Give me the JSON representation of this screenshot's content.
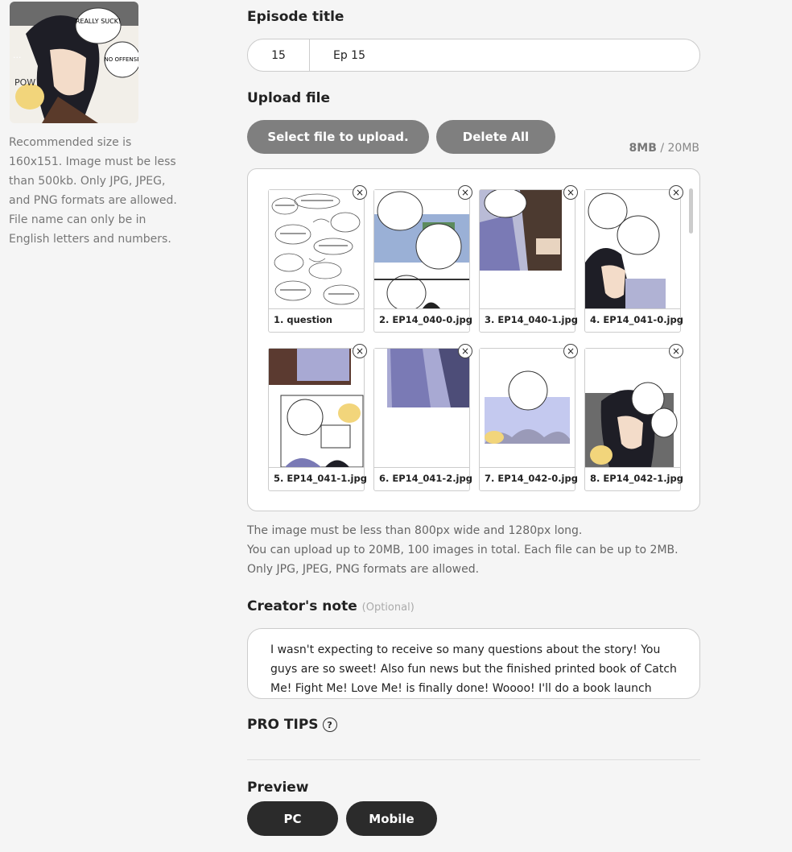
{
  "thumbnail": {
    "bubble1": "REALLY SUCK!",
    "bubble2": "NO OFFENSE",
    "sfx1": "...",
    "sfx2": "POW"
  },
  "thumbnail_help": "Recommended size is 160x151. Image must be less than 500kb. Only JPG, JPEG, and PNG formats are allowed. File name can only be in English letters and numbers.",
  "episode": {
    "label": "Episode title",
    "number": "15",
    "title": "Ep 15"
  },
  "upload": {
    "label": "Upload file",
    "select_button": "Select file to upload.",
    "delete_all_button": "Delete All",
    "used": "8MB",
    "separator": " / ",
    "limit": "20MB",
    "files": [
      {
        "name": "1. question"
      },
      {
        "name": "2. EP14_040-0.jpg"
      },
      {
        "name": "3. EP14_040-1.jpg"
      },
      {
        "name": "4. EP14_041-0.jpg"
      },
      {
        "name": "5. EP14_041-1.jpg"
      },
      {
        "name": "6. EP14_041-2.jpg"
      },
      {
        "name": "7. EP14_042-0.jpg"
      },
      {
        "name": "8. EP14_042-1.jpg"
      }
    ],
    "close_glyph": "×",
    "help_lines": [
      "The image must be less than 800px wide and 1280px long.",
      "You can upload up to 20MB, 100 images in total. Each file can be up to 2MB.",
      "Only JPG, JPEG, PNG formats are allowed."
    ]
  },
  "creators_note": {
    "label": "Creator's note",
    "optional": "(Optional)",
    "text": "I wasn't expecting to receive so many questions about the story! You guys are so sweet! Also fun news but the finished printed book of Catch Me! Fight Me! Love Me! is finally done! Woooo! I'll do a book launch"
  },
  "pro_tips": {
    "label": "PRO TIPS",
    "help_glyph": "?"
  },
  "preview": {
    "label": "Preview",
    "pc_button": "PC",
    "mobile_button": "Mobile"
  },
  "colors": {
    "button_gray": "#7f7f7f",
    "button_dark": "#2b2b2b",
    "background": "#f5f5f5"
  }
}
